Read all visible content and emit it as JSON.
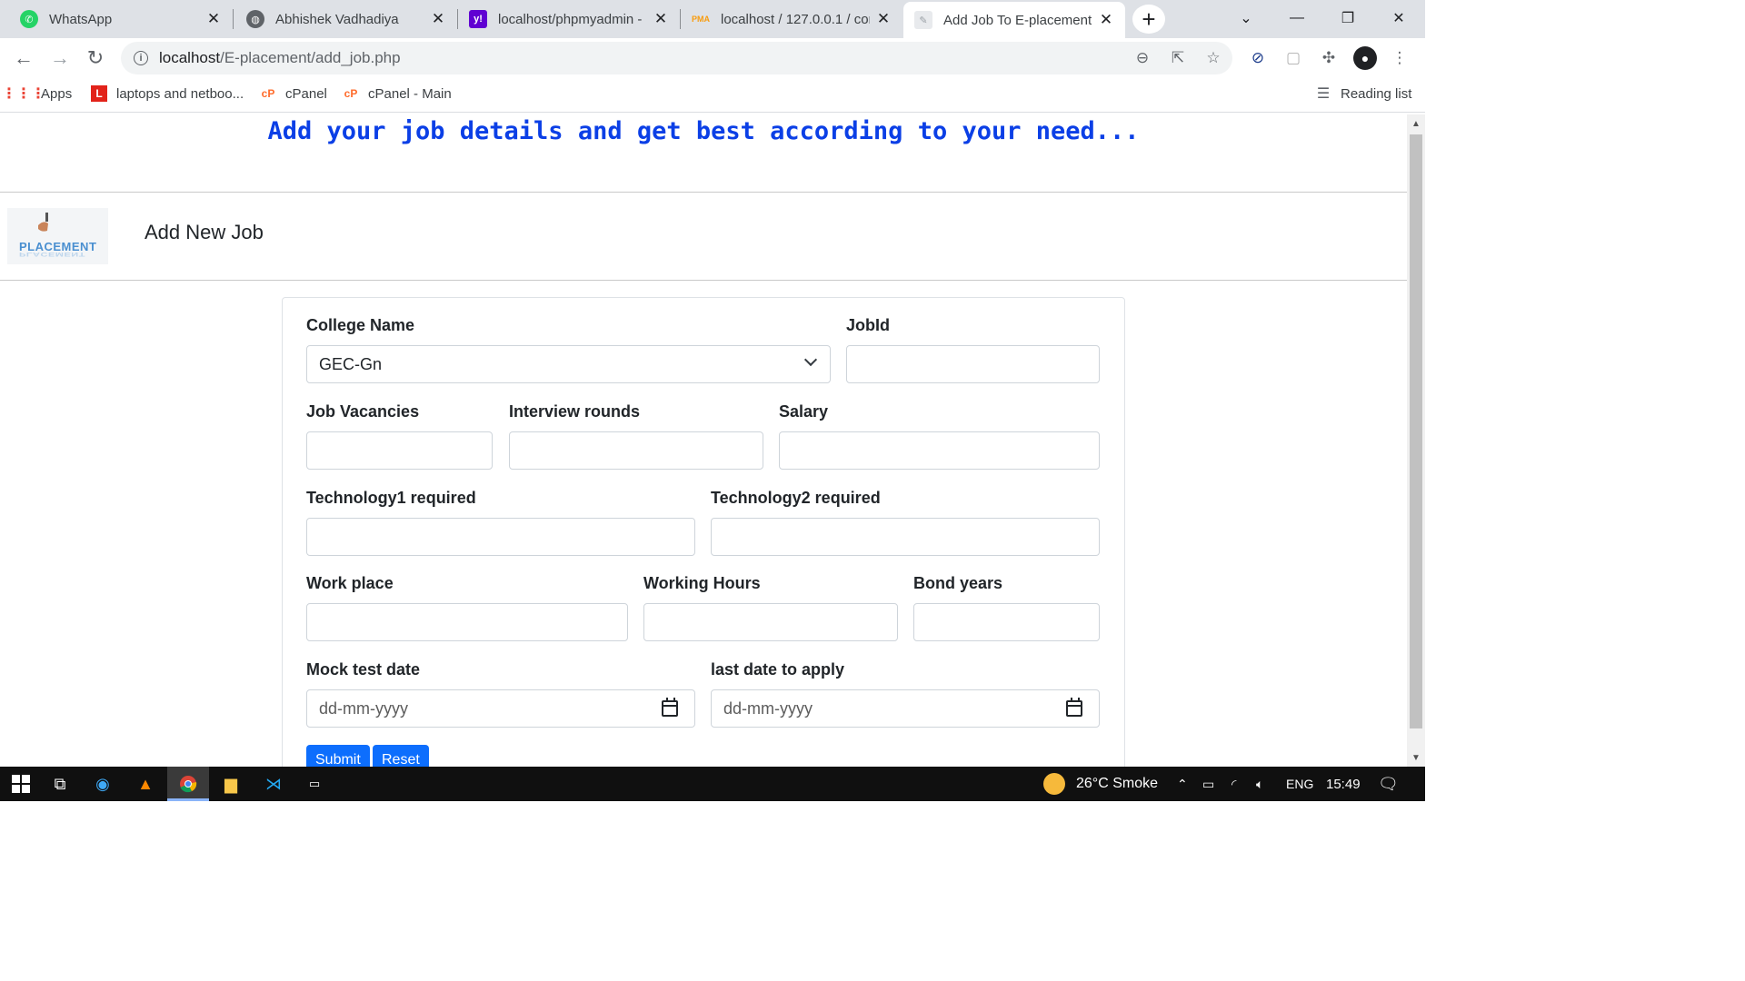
{
  "browser": {
    "tabs": [
      {
        "title": "WhatsApp",
        "icon": "whatsapp-icon",
        "color": "#25d366"
      },
      {
        "title": "Abhishek Vadhadiya",
        "icon": "globe-icon",
        "color": "#5f6368"
      },
      {
        "title": "localhost/phpmyadmin -",
        "icon": "yahoo-icon",
        "color": "#6001d2"
      },
      {
        "title": "localhost / 127.0.0.1 / con",
        "icon": "phpmyadmin-icon",
        "color": "#f89c0e"
      },
      {
        "title": "Add Job To E-placement",
        "icon": "eplacement-icon",
        "color": "#9aa0a6"
      }
    ],
    "url_host": "localhost",
    "url_path": "/E-placement/add_job.php",
    "bookmarks": [
      {
        "label": "Apps",
        "icon": "apps-grid-icon"
      },
      {
        "label": "laptops and netboo...",
        "icon": "lenovo-icon"
      },
      {
        "label": "cPanel",
        "icon": "cpanel-icon"
      },
      {
        "label": "cPanel - Main",
        "icon": "cpanel-icon"
      }
    ],
    "reading_list": "Reading list"
  },
  "page": {
    "banner": "Add your job details and get best according to your need...",
    "logo_text": "PLACEMENT",
    "heading": "Add New Job",
    "form": {
      "college_name_label": "College Name",
      "college_name_value": "GEC-Gn",
      "jobid_label": "JobId",
      "vacancies_label": "Job Vacancies",
      "interview_rounds_label": "Interview rounds",
      "salary_label": "Salary",
      "tech1_label": "Technology1 required",
      "tech2_label": "Technology2 required",
      "workplace_label": "Work place",
      "working_hours_label": "Working Hours",
      "bond_years_label": "Bond years",
      "mock_test_label": "Mock test date",
      "mock_test_placeholder": "dd-mm-yyyy",
      "last_date_label": "last date to apply",
      "last_date_placeholder": "dd-mm-yyyy",
      "submit_label": "Submit",
      "reset_label": "Reset"
    },
    "accent_color": "#0d6efd",
    "banner_color": "#0b3fe6"
  },
  "taskbar": {
    "weather": "26°C  Smoke",
    "language": "ENG",
    "time": "15:49"
  }
}
